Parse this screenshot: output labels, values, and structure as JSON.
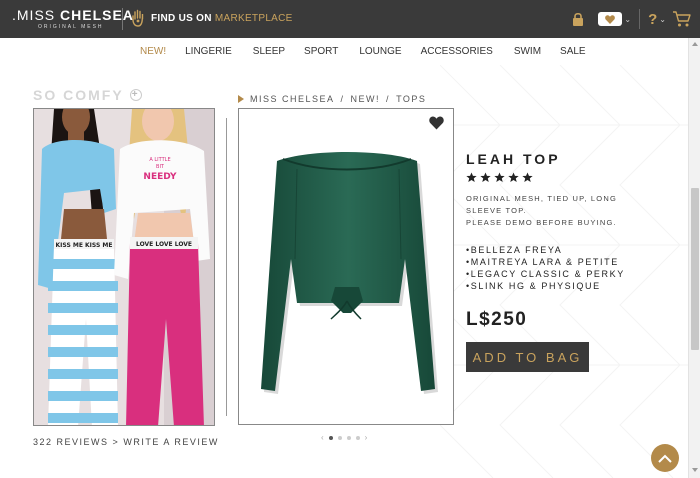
{
  "header": {
    "brand_miss": ".MISS",
    "brand_chelsea": "CHELSEA",
    "brand_sub": "ORIGINAL MESH",
    "find_label": "FIND US ON",
    "find_link": "MARKETPLACE",
    "icons": [
      "lock-icon",
      "heart-icon",
      "chevron-down-icon",
      "help-icon",
      "cart-icon"
    ],
    "help_label": "?"
  },
  "nav": {
    "items": [
      {
        "label": "NEW!",
        "active": true
      },
      {
        "label": "LINGERIE",
        "active": false
      },
      {
        "label": "SLEEP",
        "active": false
      },
      {
        "label": "SPORT",
        "active": false
      },
      {
        "label": "LOUNGE",
        "active": false
      },
      {
        "label": "ACCESSORIES",
        "active": false
      },
      {
        "label": "SWIM",
        "active": false
      },
      {
        "label": "SALE",
        "active": false
      }
    ]
  },
  "collection": {
    "title": "SO COMFY",
    "plus": "+",
    "model_shirt_text_1": "A LITTLE",
    "model_shirt_text_2": "BIT",
    "model_shirt_text_3": "NEEDY",
    "waistband_text_1": "KISS ME KISS ME",
    "waistband_text_2": "LOVE LOVE LOVE"
  },
  "reviews": {
    "count_text": "322 REVIEWS",
    "separator": ">",
    "write_text": "WRITE A REVIEW"
  },
  "breadcrumb": {
    "items": [
      "MISS CHELSEA",
      "NEW!",
      "TOPS"
    ],
    "separator": "/"
  },
  "product": {
    "name": "LEAH TOP",
    "rating": 5,
    "rating_max": 5,
    "description_line1": "ORIGINAL MESH, TIED UP, LONG",
    "description_line2": "SLEEVE TOP.",
    "description_line3": "PLEASE DEMO BEFORE BUYING.",
    "compatibility": [
      "•BELLEZA FREYA",
      "•MAITREYA LARA & PETITE",
      "•LEGACY CLASSIC & PERKY",
      "•SLINK HG & PHYSIQUE"
    ],
    "price": "L$250",
    "add_to_bag": "ADD TO BAG",
    "image_color": "#1f5a47"
  },
  "carousel": {
    "prev": "‹",
    "next": "›",
    "dot_count": 4,
    "active_dot": 0
  },
  "colors": {
    "accent": "#b38a4a",
    "dark": "#3a3a3a",
    "top_green": "#1f5a47",
    "shirt_blue": "#7fc6e8",
    "pants_pink": "#d92f7e"
  }
}
